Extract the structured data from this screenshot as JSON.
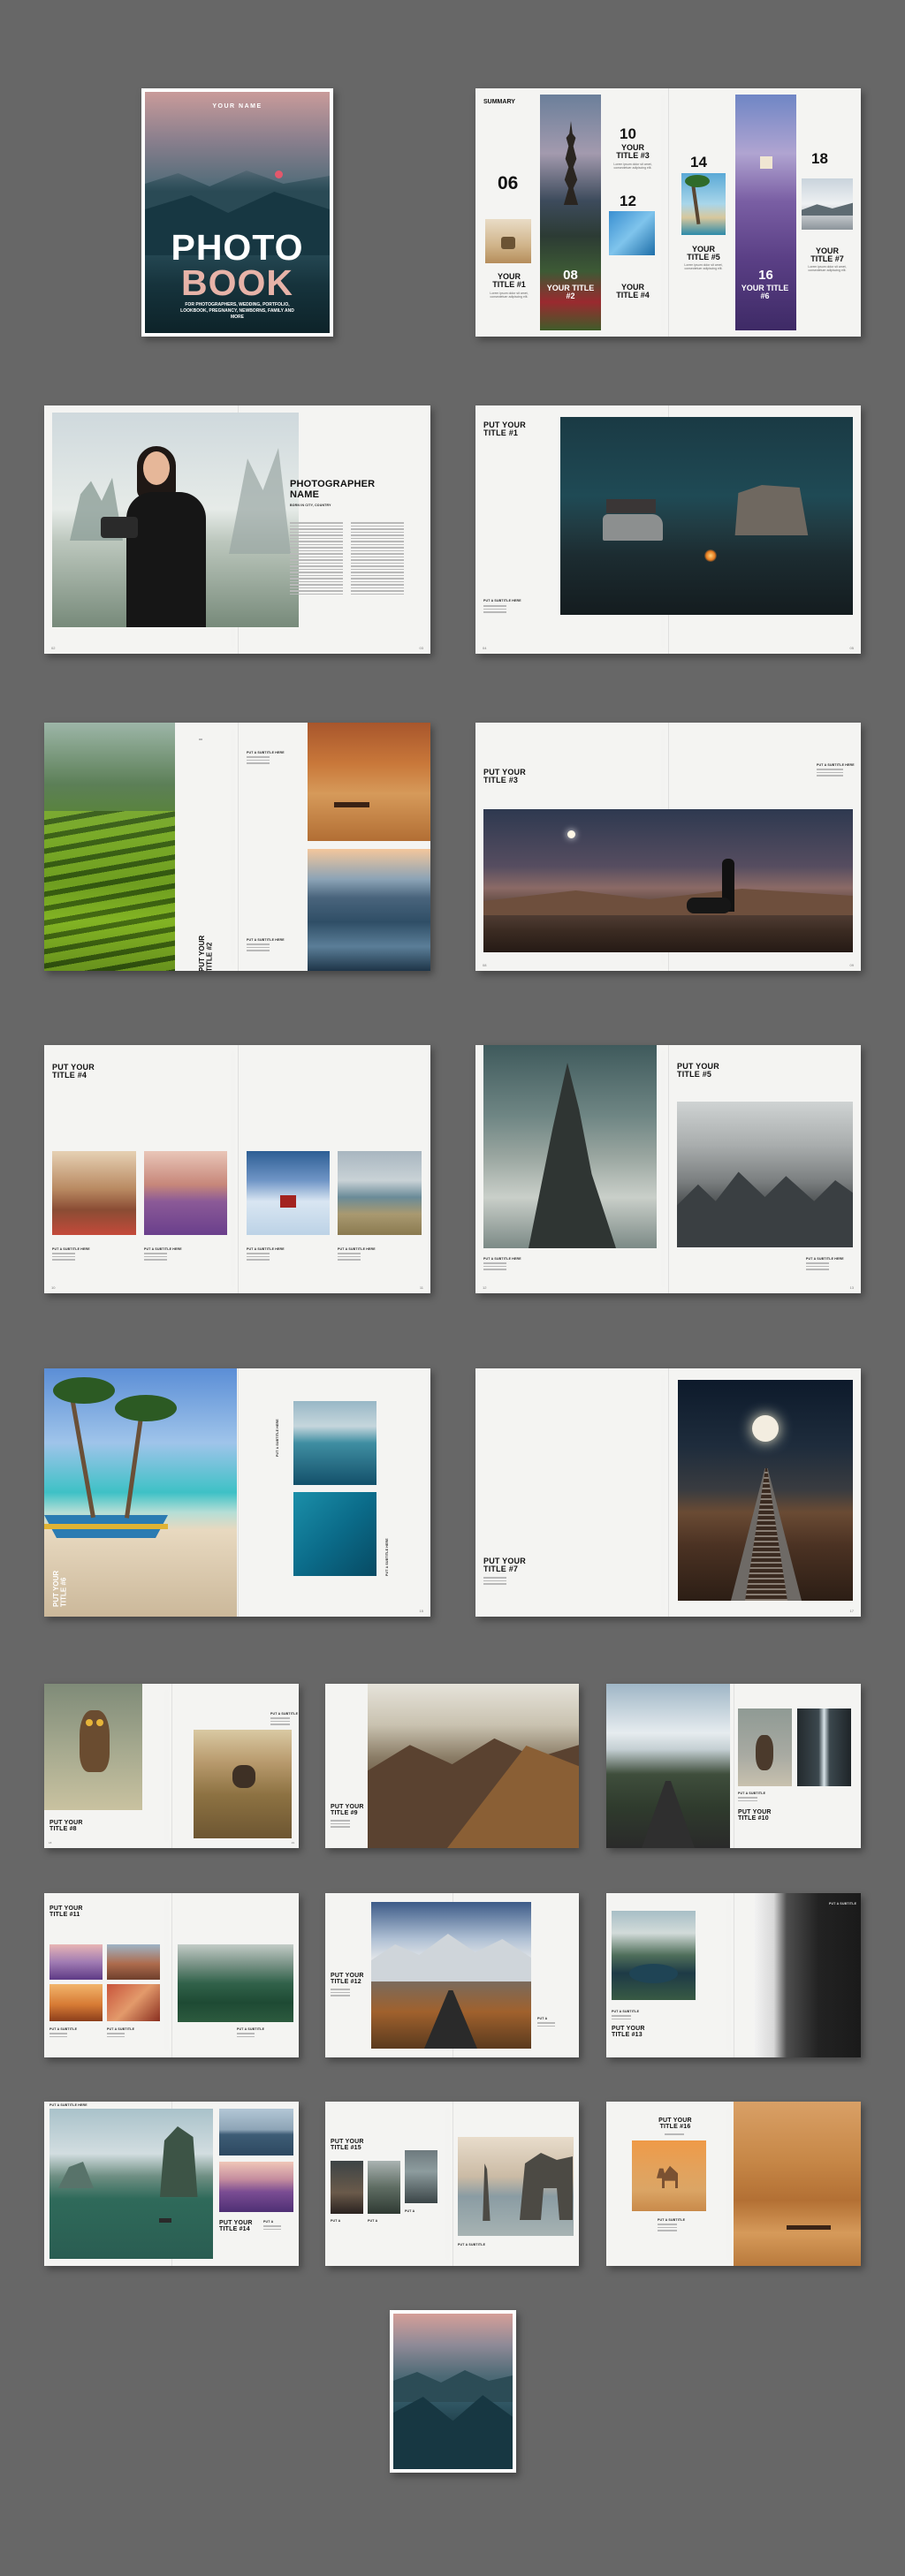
{
  "cover": {
    "your_name": "YOUR NAME",
    "photo": "PHOTO",
    "book": "BOOK",
    "tagline": "FOR PHOTOGRAPHERS, WEDDING, PORTFOLIO, LOOKBOOK, PREGNANCY, NEWBORNS, FAMILY AND MORE"
  },
  "summary": {
    "heading": "SUMMARY",
    "items": [
      {
        "num": "06",
        "title": "YOUR TITLE #1"
      },
      {
        "num": "08",
        "title": "YOUR TITLE #2"
      },
      {
        "num": "10",
        "title": "YOUR TITLE #3"
      },
      {
        "num": "12",
        "title": "YOUR TITLE #4"
      },
      {
        "num": "14",
        "title": "YOUR TITLE #5"
      },
      {
        "num": "16",
        "title": "YOUR TITLE #6"
      },
      {
        "num": "18",
        "title": "YOUR TITLE #7"
      }
    ]
  },
  "photographer": {
    "name": "PHOTOGRAPHER NAME",
    "location": "BORN IN CITY, COUNTRY"
  },
  "titles": {
    "t1": "PUT YOUR TITLE #1",
    "t2": "PUT YOUR TITLE #2",
    "t3": "PUT YOUR TITLE #3",
    "t4": "PUT YOUR TITLE #4",
    "t5": "PUT YOUR TITLE #5",
    "t6": "PUT YOUR TITLE #6",
    "t7": "PUT YOUR TITLE #7",
    "t8": "PUT YOUR TITLE #8",
    "t9": "PUT YOUR TITLE #9",
    "t10": "PUT YOUR TITLE #10",
    "t11": "PUT YOUR TITLE #11",
    "t12": "PUT YOUR TITLE #12",
    "t13": "PUT YOUR TITLE #13",
    "t14": "PUT YOUR TITLE #14",
    "t15": "PUT YOUR TITLE #15",
    "t16": "PUT YOUR TITLE #16"
  },
  "subtitle": "PUT A SUBTITLE HERE"
}
